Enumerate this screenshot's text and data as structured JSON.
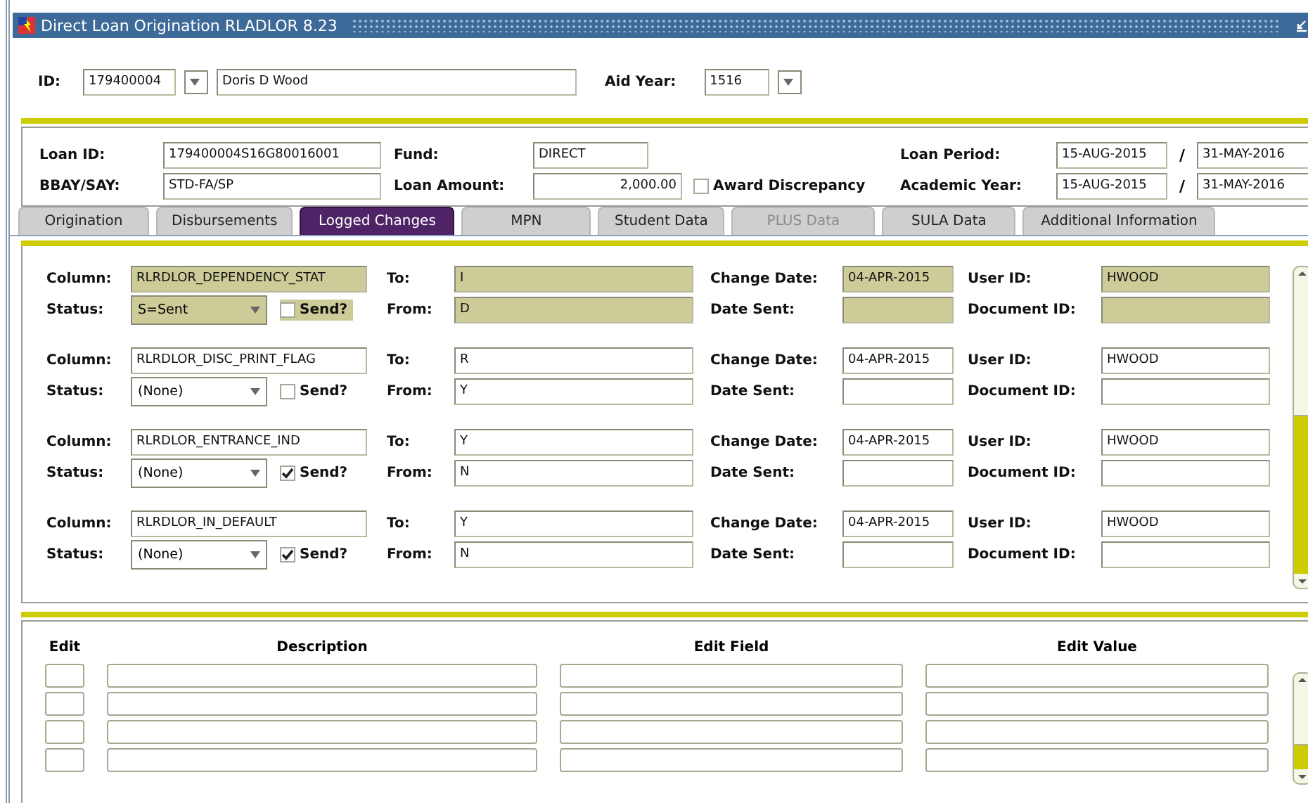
{
  "window": {
    "title": "Direct Loan Origination  RLADLOR  8.23"
  },
  "key_block": {
    "id_label": "ID:",
    "id": "179400004",
    "name": "Doris D Wood",
    "aid_year_label": "Aid Year:",
    "aid_year": "1516"
  },
  "loan": {
    "loan_id_label": "Loan ID:",
    "loan_id": "179400004S16G80016001",
    "fund_label": "Fund:",
    "fund": "DIRECT",
    "loan_period_label": "Loan Period:",
    "loan_period_start": "15-AUG-2015",
    "loan_period_separator": "/",
    "loan_period_end": "31-MAY-2016",
    "bbay_say_label": "BBAY/SAY:",
    "bbay_say": "STD-FA/SP",
    "loan_amount_label": "Loan Amount:",
    "loan_amount": "2,000.00",
    "award_discrepancy": {
      "label": "Award Discrepancy",
      "checked": false
    },
    "academic_year_label": "Academic Year:",
    "academic_year_start": "15-AUG-2015",
    "academic_year_separator": "/",
    "academic_year_end": "31-MAY-2016"
  },
  "tabs": [
    {
      "label": "Origination",
      "selected": false,
      "disabled": false
    },
    {
      "label": "Disbursements",
      "selected": false,
      "disabled": false
    },
    {
      "label": "Logged Changes",
      "selected": true,
      "disabled": false
    },
    {
      "label": "MPN",
      "selected": false,
      "disabled": false
    },
    {
      "label": "Student Data",
      "selected": false,
      "disabled": false
    },
    {
      "label": "PLUS Data",
      "selected": false,
      "disabled": true
    },
    {
      "label": "SULA Data",
      "selected": false,
      "disabled": false
    },
    {
      "label": "Additional Information",
      "selected": false,
      "disabled": false
    }
  ],
  "records": [
    {
      "selected": true,
      "column_label": "Column:",
      "column": "RLRDLOR_DEPENDENCY_STAT",
      "status_label": "Status:",
      "status": "S=Sent",
      "send_label": "Send?",
      "send": false,
      "to_label": "To:",
      "to": "I",
      "from_label": "From:",
      "from": "D",
      "change_date_label": "Change Date:",
      "change_date": "04-APR-2015",
      "date_sent_label": "Date Sent:",
      "user_id_label": "User ID:",
      "user_id": "HWOOD",
      "document_id_label": "Document ID:"
    },
    {
      "selected": false,
      "column_label": "Column:",
      "column": "RLRDLOR_DISC_PRINT_FLAG",
      "status_label": "Status:",
      "status": "(None)",
      "send_label": "Send?",
      "send": false,
      "to_label": "To:",
      "to": "R",
      "from_label": "From:",
      "from": "Y",
      "change_date_label": "Change Date:",
      "change_date": "04-APR-2015",
      "date_sent_label": "Date Sent:",
      "user_id_label": "User ID:",
      "user_id": "HWOOD",
      "document_id_label": "Document ID:"
    },
    {
      "selected": false,
      "column_label": "Column:",
      "column": "RLRDLOR_ENTRANCE_IND",
      "status_label": "Status:",
      "status": "(None)",
      "send_label": "Send?",
      "send": true,
      "to_label": "To:",
      "to": "Y",
      "from_label": "From:",
      "from": "N",
      "change_date_label": "Change Date:",
      "change_date": "04-APR-2015",
      "date_sent_label": "Date Sent:",
      "user_id_label": "User ID:",
      "user_id": "HWOOD",
      "document_id_label": "Document ID:"
    },
    {
      "selected": false,
      "column_label": "Column:",
      "column": "RLRDLOR_IN_DEFAULT",
      "status_label": "Status:",
      "status": "(None)",
      "send_label": "Send?",
      "send": true,
      "to_label": "To:",
      "to": "Y",
      "from_label": "From:",
      "from": "N",
      "change_date_label": "Change Date:",
      "change_date": "04-APR-2015",
      "date_sent_label": "Date Sent:",
      "user_id_label": "User ID:",
      "user_id": "HWOOD",
      "document_id_label": "Document ID:"
    }
  ],
  "edit_table": {
    "columns": [
      "Edit",
      "Description",
      "Edit Field",
      "Edit Value"
    ]
  }
}
